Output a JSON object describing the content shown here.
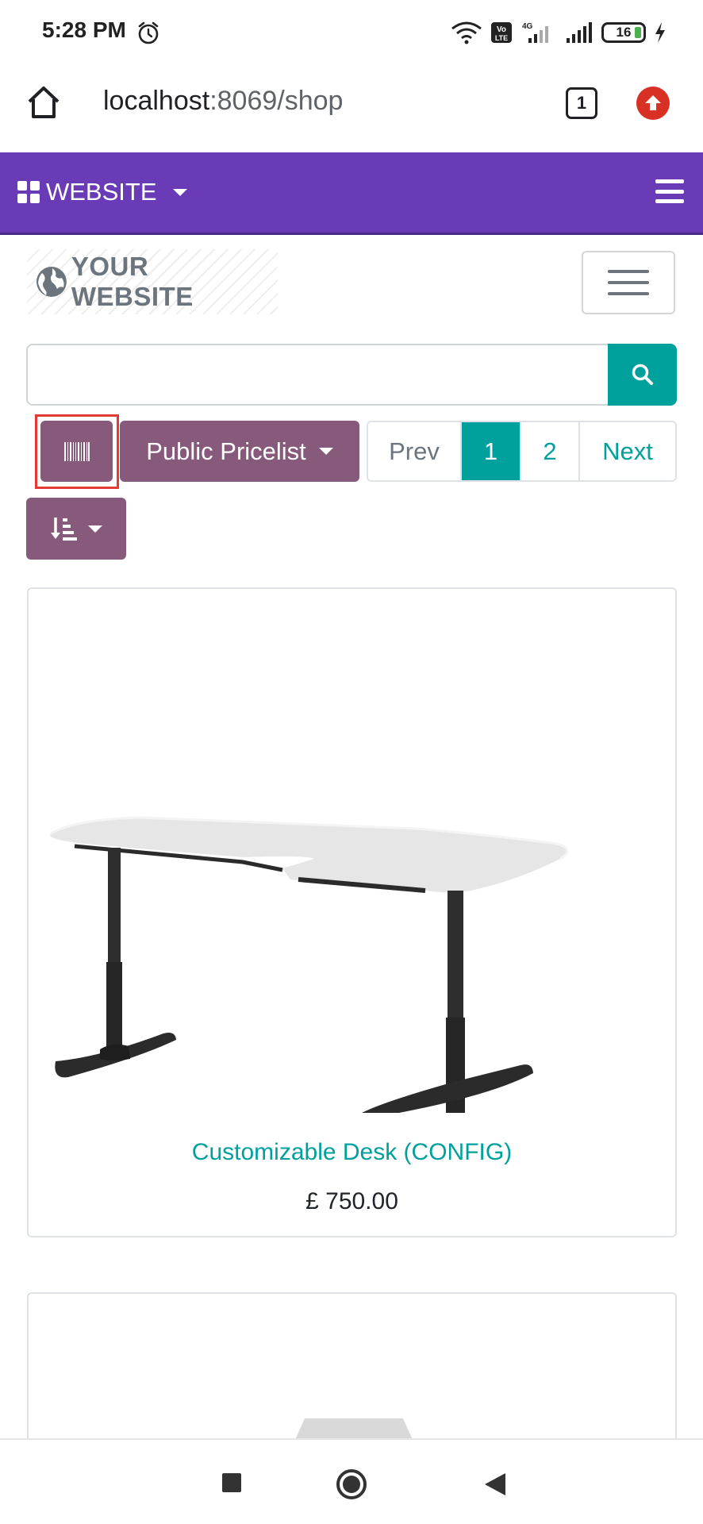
{
  "status_bar": {
    "time": "5:28 PM",
    "battery_level": "16"
  },
  "browser": {
    "url_host": "localhost",
    "url_path": ":8069/shop",
    "tab_count": "1"
  },
  "admin_bar": {
    "brand_label": "WEBSITE"
  },
  "site": {
    "logo_text": "YOUR WEBSITE"
  },
  "search": {
    "value": "",
    "placeholder": ""
  },
  "toolbar": {
    "pricelist_label": "Public Pricelist",
    "pager": {
      "prev_label": "Prev",
      "pages": [
        "1",
        "2"
      ],
      "current_page": "1",
      "next_label": "Next"
    }
  },
  "products": [
    {
      "name": "Customizable Desk (CONFIG)",
      "price": "£ 750.00"
    }
  ],
  "colors": {
    "admin_bar": "#6a3bb6",
    "odoo_purple": "#875a7b",
    "odoo_teal": "#00a09d",
    "highlight_border": "#e53935"
  }
}
